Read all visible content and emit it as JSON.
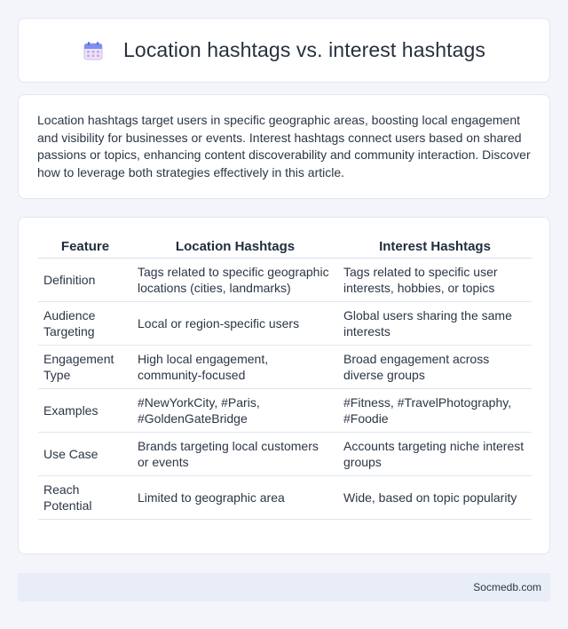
{
  "header": {
    "title": "Location hashtags vs. interest hashtags",
    "icon": "calendar-icon"
  },
  "intro": {
    "text": "Location hashtags target users in specific geographic areas, boosting local engagement and visibility for businesses or events. Interest hashtags connect users based on shared passions or topics, enhancing content discoverability and community interaction. Discover how to leverage both strategies effectively in this article."
  },
  "table": {
    "headers": [
      "Feature",
      "Location Hashtags",
      "Interest Hashtags"
    ],
    "rows": [
      [
        "Definition",
        "Tags related to specific geographic locations (cities, landmarks)",
        "Tags related to specific user interests, hobbies, or topics"
      ],
      [
        "Audience Targeting",
        "Local or region-specific users",
        "Global users sharing the same interests"
      ],
      [
        "Engagement Type",
        "High local engagement, community-focused",
        "Broad engagement across diverse groups"
      ],
      [
        "Examples",
        "#NewYorkCity, #Paris, #GoldenGateBridge",
        "#Fitness, #TravelPhotography, #Foodie"
      ],
      [
        "Use Case",
        "Brands targeting local customers or events",
        "Accounts targeting niche interest groups"
      ],
      [
        "Reach Potential",
        "Limited to geographic area",
        "Wide, based on topic popularity"
      ]
    ]
  },
  "footer": {
    "site": "Socmedb.com"
  }
}
